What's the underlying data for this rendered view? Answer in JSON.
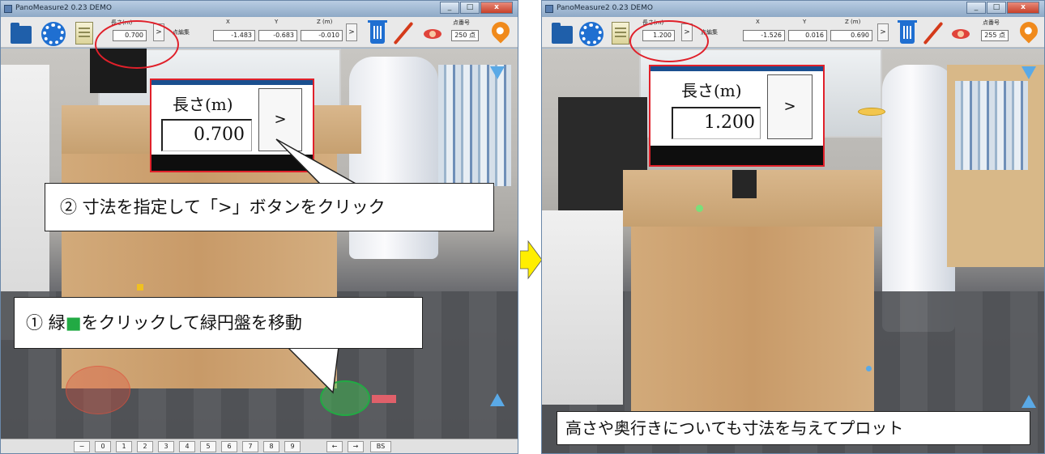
{
  "left": {
    "window_title": "PanoMeasure2 0.23 DEMO",
    "toolbar": {
      "length_label": "長さ(m)",
      "length_value": "0.700",
      "go_button": ">",
      "edit_label": "点編集",
      "x_label": "X",
      "y_label": "Y",
      "z_label": "Z (m)",
      "x_value": "-1.483",
      "y_value": "-0.683",
      "z_value": "-0.010",
      "coord_go_button": ">",
      "point_label": "点番号",
      "point_value": "250 点"
    },
    "zoom": {
      "label": "長さ(m)",
      "value": "0.700",
      "button": ">"
    },
    "callout_top": "② 寸法を指定して「>」ボタンをクリック",
    "callout_bottom_prefix": "① 緑",
    "callout_bottom_square": "■",
    "callout_bottom_suffix": "をクリックして緑円盤を移動",
    "keys": [
      "−",
      "0",
      "1",
      "2",
      "3",
      "4",
      "5",
      "6",
      "7",
      "8",
      "9",
      "←",
      "→",
      "BS"
    ]
  },
  "right": {
    "window_title": "PanoMeasure2 0.23 DEMO",
    "toolbar": {
      "length_label": "長さ(m)",
      "length_value": "1.200",
      "go_button": ">",
      "edit_label": "点編集",
      "x_label": "X",
      "y_label": "Y",
      "z_label": "Z (m)",
      "x_value": "-1.526",
      "y_value": "0.016",
      "z_value": "0.690",
      "coord_go_button": ">",
      "point_label": "点番号",
      "point_value": "255 点"
    },
    "zoom": {
      "label": "長さ(m)",
      "value": "1.200",
      "button": ">"
    },
    "caption": "高さや奥行きについても寸法を与えてプロット"
  },
  "colors": {
    "highlight_red": "#e0202a",
    "arrow_yellow": "#ffee00",
    "marker_green": "#22aa44",
    "nav_blue": "#5aa9e6"
  }
}
